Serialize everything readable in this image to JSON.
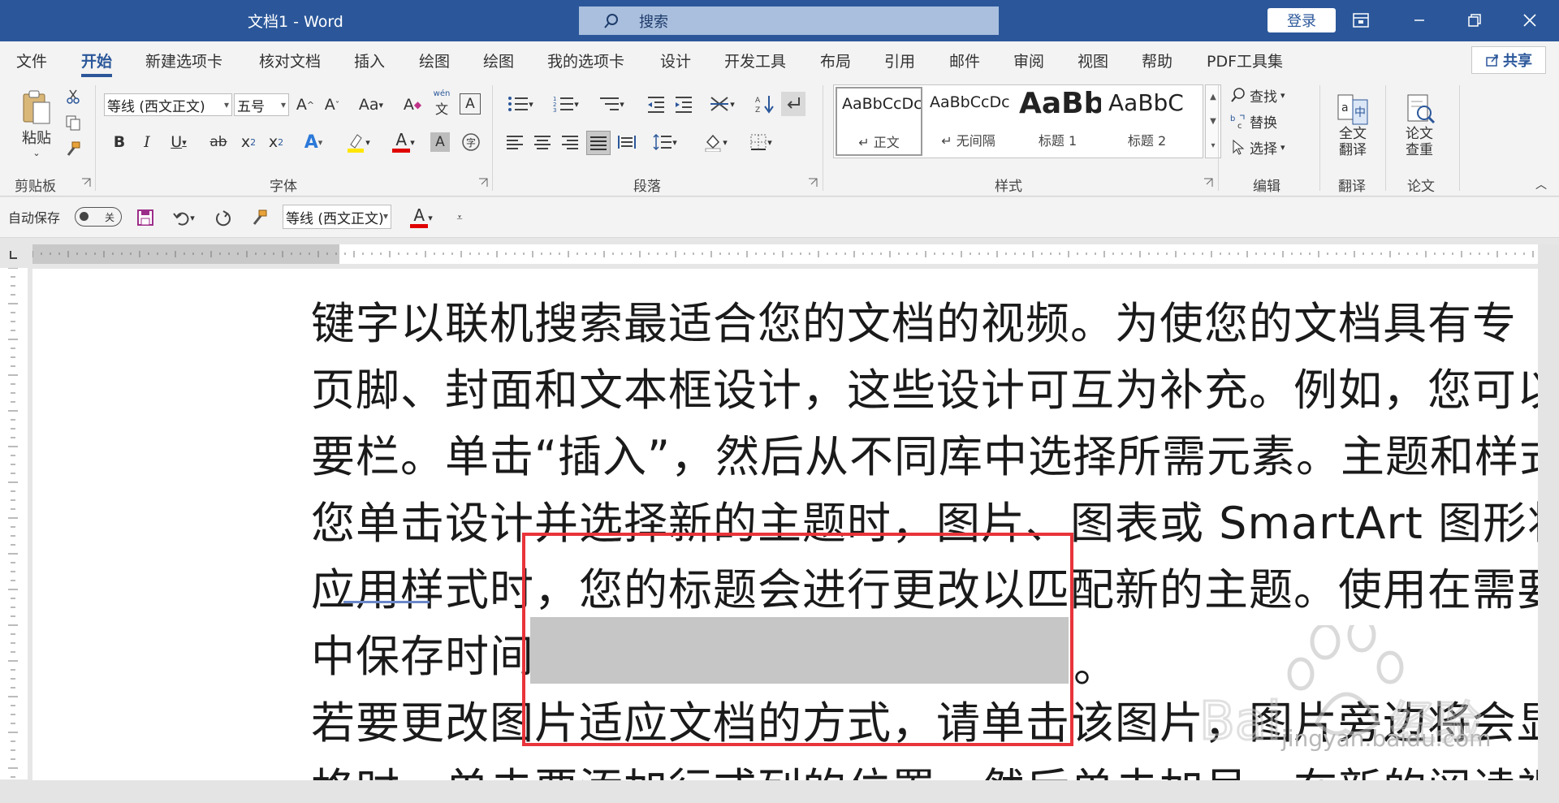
{
  "titlebar": {
    "title": "文档1  -  Word",
    "search_placeholder": "搜索",
    "login": "登录"
  },
  "tabs": [
    "文件",
    "开始",
    "新建选项卡",
    "核对文档",
    "插入",
    "绘图",
    "绘图",
    "我的选项卡",
    "设计",
    "开发工具",
    "布局",
    "引用",
    "邮件",
    "审阅",
    "视图",
    "帮助",
    "PDF工具集"
  ],
  "share": "共享",
  "ribbon": {
    "clipboard": {
      "paste": "粘贴",
      "label": "剪贴板"
    },
    "font": {
      "font_name": "等线 (西文正文)",
      "font_size": "五号",
      "label": "字体"
    },
    "paragraph": {
      "label": "段落"
    },
    "styles": {
      "label": "样式",
      "items": [
        {
          "preview": "AaBbCcDc",
          "name": "↵ 正文"
        },
        {
          "preview": "AaBbCcDc",
          "name": "↵ 无间隔"
        },
        {
          "preview": "AaBb",
          "name": "标题 1"
        },
        {
          "preview": "AaBbC",
          "name": "标题 2"
        }
      ]
    },
    "editing": {
      "find": "查找",
      "replace": "替换",
      "select": "选择",
      "label": "编辑"
    },
    "translate": {
      "btn": "全文\n翻译",
      "label": "翻译"
    },
    "paper": {
      "btn": "论文\n查重",
      "label": "论文"
    }
  },
  "qat": {
    "autosave": "自动保存",
    "autosave_state": "关",
    "font": "等线 (西文正文)"
  },
  "document": {
    "lines": [
      "键字以联机搜索最适合您的文档的视频。为使您的文档具有专",
      "页脚、封面和文本框设计，这些设计可互为补充。例如，您可以",
      "要栏。单击“插入”，然后从不同库中选择所需元素。主题和样式",
      "您单击设计并选择新的主题时，图片、图表或 SmartArt 图形将",
      "应用样式时，您的标题会进行更改以匹配新的主题。使用在需要",
      "中保存时间",
      "若要更改图片适应文档的方式，请单击该图片，图片旁边将会显",
      "格时，单击要添加行或列的位置，然后单击加号。在新的阅读视"
    ],
    "line_end_period": "。"
  },
  "watermark": {
    "text": "jingyan.baidu.com"
  },
  "colors": {
    "accent": "#2b579a",
    "highlight_box": "#e8343a",
    "selection_gray": "#c6c6c6"
  }
}
